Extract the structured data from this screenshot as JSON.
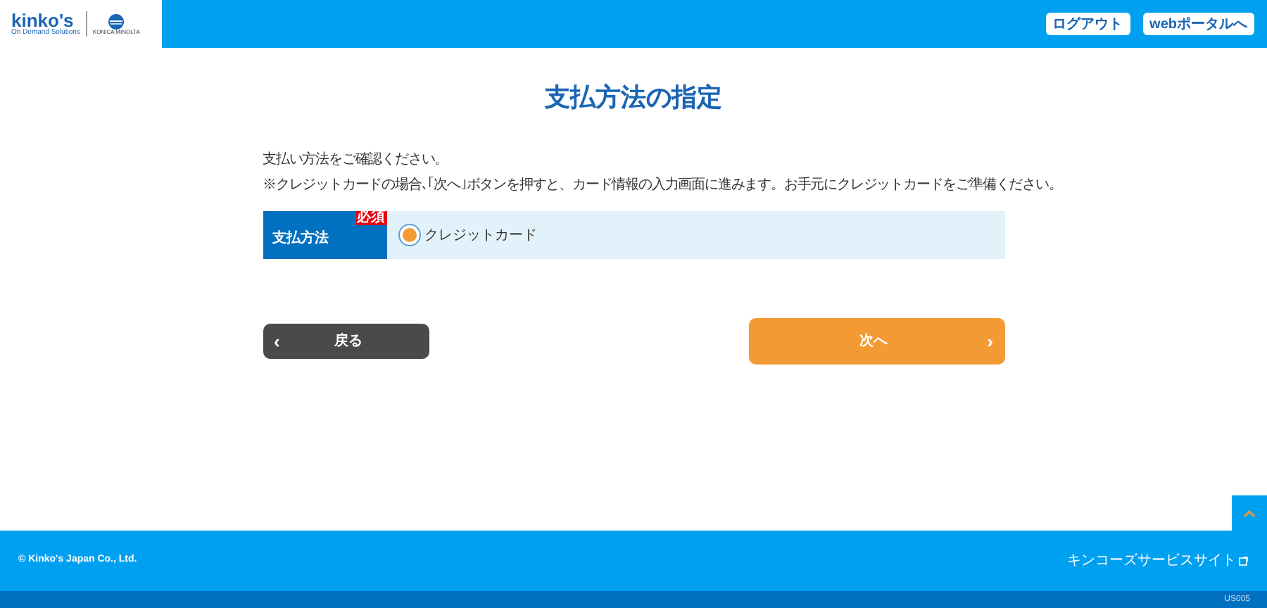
{
  "header": {
    "logo": {
      "brand": "kinko's",
      "tagline": "On Demand Solutions",
      "partner": "KONICA MINOLTA"
    },
    "buttons": [
      "ログアウト",
      "webポータルへ"
    ]
  },
  "page": {
    "title": "支払方法の指定",
    "notes": [
      "支払い方法をご確認ください。",
      "※クレジットカードの場合､｢次へ｣ボタンを押すと、カード情報の入力画面に進みます。お手元にクレジットカードをご準備ください。"
    ]
  },
  "form": {
    "label": "支払方法",
    "required_badge": "必須",
    "options": [
      {
        "label": "クレジットカード",
        "selected": true
      }
    ]
  },
  "actions": {
    "back": {
      "label": "戻る",
      "arrow": "‹"
    },
    "next": {
      "label": "次へ",
      "arrow": "›"
    }
  },
  "footer": {
    "copyright": "© Kinko's Japan Co., Ltd.",
    "link": "キンコーズサービスサイト",
    "screen_id": "US005"
  }
}
